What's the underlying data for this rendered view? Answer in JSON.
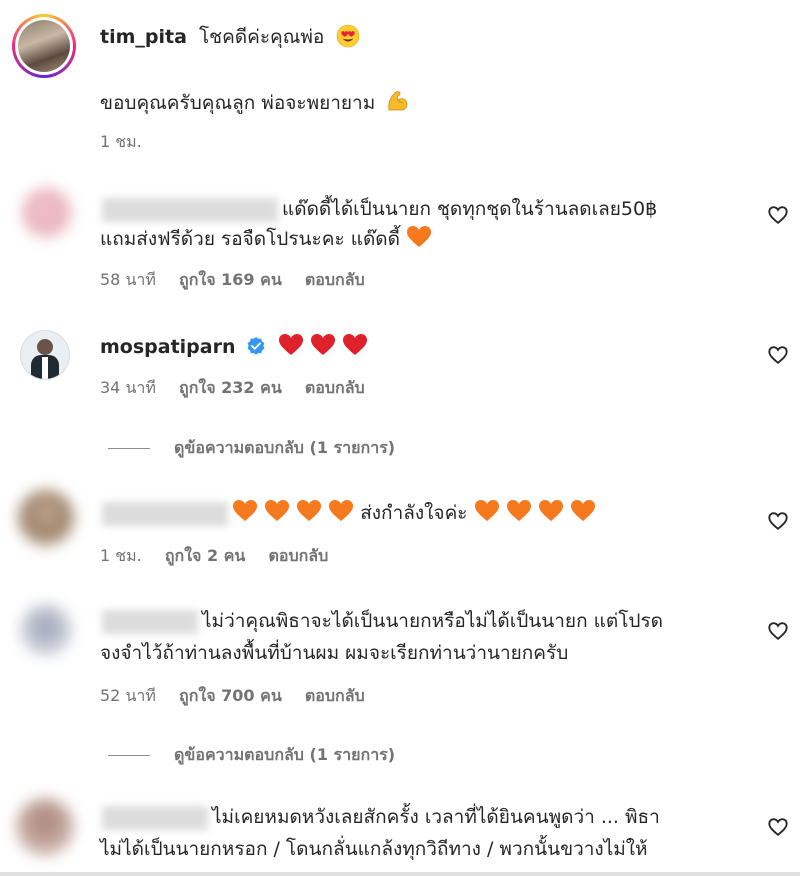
{
  "comments": [
    {
      "username": "tim_pita",
      "text": "โชคดีค่ะคุณพ่อ",
      "reply_text": "ขอบคุณครับคุณลูก พ่อจะพยายาม",
      "time": "1 ชม."
    },
    {
      "line1": "แด๊ดดี้ได้เป็นนายก ชุดทุกชุดในร้านลดเลย50฿",
      "line2": "แถมส่งฟรีด้วย รอจืดโปรนะคะ แด๊ดดี้",
      "time": "58 นาที",
      "likes": "ถูกใจ 169 คน",
      "reply": "ตอบกลับ"
    },
    {
      "username": "mospatiparn",
      "time": "34 นาที",
      "likes": "ถูกใจ 232 คน",
      "reply": "ตอบกลับ",
      "view_replies": "ดูข้อความตอบกลับ (1 รายการ)"
    },
    {
      "text": "ส่งกำลังใจค่ะ",
      "time": "1 ชม.",
      "likes": "ถูกใจ 2 คน",
      "reply": "ตอบกลับ"
    },
    {
      "line1": "ไม่ว่าคุณพิธาจะได้เป็นนายกหรือไม่ได้เป็นนายก แต่โปรด",
      "line2": "จงจำไว้ถ้าท่านลงพื้นที่บ้านผม ผมจะเรียกท่านว่านายกครับ",
      "time": "52 นาที",
      "likes": "ถูกใจ 700 คน",
      "reply": "ตอบกลับ",
      "view_replies": "ดูข้อความตอบกลับ (1 รายการ)"
    },
    {
      "line1": "ไม่เคยหมดหวังเลยสักครั้ง เวลาที่ได้ยินคนพูดว่า ... พิธา",
      "line2": "ไม่ได้เป็นนายกหรอก / โดนกลั่นแกล้งทุกวิถีทาง / พวกนั้นขวางไม่ให้"
    }
  ],
  "colors": {
    "orange_heart": "#f7791e",
    "red_heart": "#e0202b",
    "verified_blue": "#3897f0",
    "meta_gray": "#737373"
  },
  "icons": {
    "like": "heart-outline-icon",
    "verified": "verified-badge-icon",
    "emoji_love": "heart-eyes-emoji",
    "emoji_muscle": "flexed-biceps-emoji"
  }
}
